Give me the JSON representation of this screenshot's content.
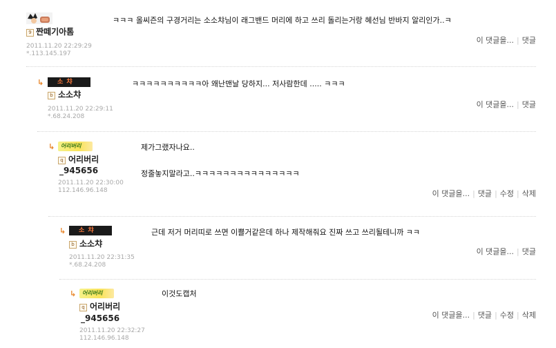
{
  "comments": [
    {
      "nick": "짠떼기아톰",
      "date": "2011.11.20 22:29:29",
      "ip": "*.113.145.197",
      "grade": "9",
      "text": "ㅋㅋㅋ 올씨즌의 구경거리는 소소챠님이 래그밴드 머리에 하고 쓰리 돌리는거랑 혜선님 반바지 알리인가..ㅋ",
      "actions": [
        "이 댓글을...",
        "댓글"
      ]
    },
    {
      "nick": "소소챠",
      "date": "2011.11.20 22:29:11",
      "ip": "*.68.24.208",
      "grade": "b",
      "avatar_label": "소 챠",
      "text": "ㅋㅋㅋㅋㅋㅋㅋㅋㅋㅋ아 왜난맨날 당하지... 저사람한데 ..... ㅋㅋㅋ",
      "actions": [
        "이 댓글을...",
        "댓글"
      ]
    },
    {
      "nick_line1": "어리버리",
      "nick_line2": "_945656",
      "date": "2011.11.20 22:30:00",
      "ip": "112.146.96.148",
      "grade": "q",
      "avatar_label": "어리버리",
      "text_line1": "제가그랬자나요..",
      "text_line2": "정줄놓지말라고..ㅋㅋㅋㅋㅋㅋㅋㅋㅋㅋㅋㅋㅋㅋㅋ",
      "actions": [
        "이 댓글을...",
        "댓글",
        "수정",
        "삭제"
      ]
    },
    {
      "nick": "소소챠",
      "date": "2011.11.20 22:31:35",
      "ip": "*.68.24.208",
      "grade": "b",
      "avatar_label": "소 챠",
      "text": "근데 저거 머리띠로 쓰면 이쁠거같은데 하나 제작해줘요 진짜 쓰고 쓰리될테니까 ㅋㅋ",
      "actions": [
        "이 댓글을...",
        "댓글"
      ]
    },
    {
      "nick_line1": "어리버리",
      "nick_line2": "_945656",
      "date": "2011.11.20 22:32:27",
      "ip": "112.146.96.148",
      "grade": "q",
      "avatar_label": "어리버리",
      "text": "이것도캡처",
      "actions": [
        "이 댓글을...",
        "댓글",
        "수정",
        "삭제"
      ]
    }
  ],
  "colors": {
    "arrow": "#e8862a",
    "meta": "#a8a8a8",
    "separator": "#d4d4d4"
  },
  "icons": [
    "manga-avatar-icon",
    "reply-arrow-icon",
    "grade-icon"
  ]
}
